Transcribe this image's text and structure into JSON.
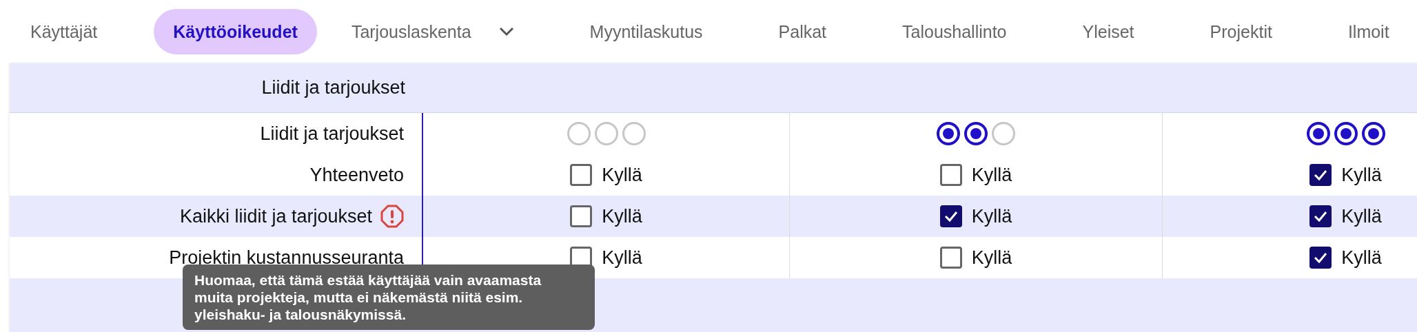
{
  "tabs": [
    {
      "label": "Käyttäjät",
      "selected": false,
      "has_menu": false
    },
    {
      "label": "Käyttöoikeudet",
      "selected": true,
      "has_menu": false
    },
    {
      "label": "Tarjouslaskenta",
      "selected": false,
      "has_menu": true
    },
    {
      "label": "Myyntilaskutus",
      "selected": false,
      "has_menu": false
    },
    {
      "label": "Palkat",
      "selected": false,
      "has_menu": false
    },
    {
      "label": "Taloushallinto",
      "selected": false,
      "has_menu": false
    },
    {
      "label": "Yleiset",
      "selected": false,
      "has_menu": false
    },
    {
      "label": "Projektit",
      "selected": false,
      "has_menu": false
    },
    {
      "label": "Ilmoit",
      "selected": false,
      "has_menu": false
    }
  ],
  "section": {
    "title": "Liidit ja tarjoukset",
    "rows": [
      {
        "kind": "radios",
        "label": "Liidit ja tarjoukset",
        "shaded": false,
        "warning": false,
        "cells": [
          {
            "radios": [
              {
                "on": false
              },
              {
                "on": false
              },
              {
                "on": false
              }
            ]
          },
          {
            "radios": [
              {
                "on": true
              },
              {
                "on": true
              },
              {
                "on": false
              }
            ]
          },
          {
            "radios": [
              {
                "on": true
              },
              {
                "on": true
              },
              {
                "on": true
              }
            ]
          }
        ]
      },
      {
        "kind": "checkbox",
        "label": "Yhteenveto",
        "shaded": false,
        "warning": false,
        "cells": [
          {
            "checked": false,
            "text": "Kyllä"
          },
          {
            "checked": false,
            "text": "Kyllä"
          },
          {
            "checked": true,
            "text": "Kyllä"
          }
        ]
      },
      {
        "kind": "checkbox",
        "label": "Kaikki liidit ja tarjoukset",
        "shaded": true,
        "warning": true,
        "cells": [
          {
            "checked": false,
            "text": "Kyllä"
          },
          {
            "checked": true,
            "text": "Kyllä"
          },
          {
            "checked": true,
            "text": "Kyllä"
          }
        ]
      },
      {
        "kind": "checkbox",
        "label": "Projektin kustannusseuranta",
        "shaded": false,
        "warning": false,
        "cells": [
          {
            "checked": false,
            "text": "Kyllä"
          },
          {
            "checked": false,
            "text": "Kyllä"
          },
          {
            "checked": true,
            "text": "Kyllä"
          }
        ]
      }
    ]
  },
  "tooltip": {
    "text": "Huomaa, että tämä estää käyttäjää vain avaamasta muita projekteja, mutta ei näkemästä niitä esim. yleishaku- ja talousnäkymissä."
  }
}
